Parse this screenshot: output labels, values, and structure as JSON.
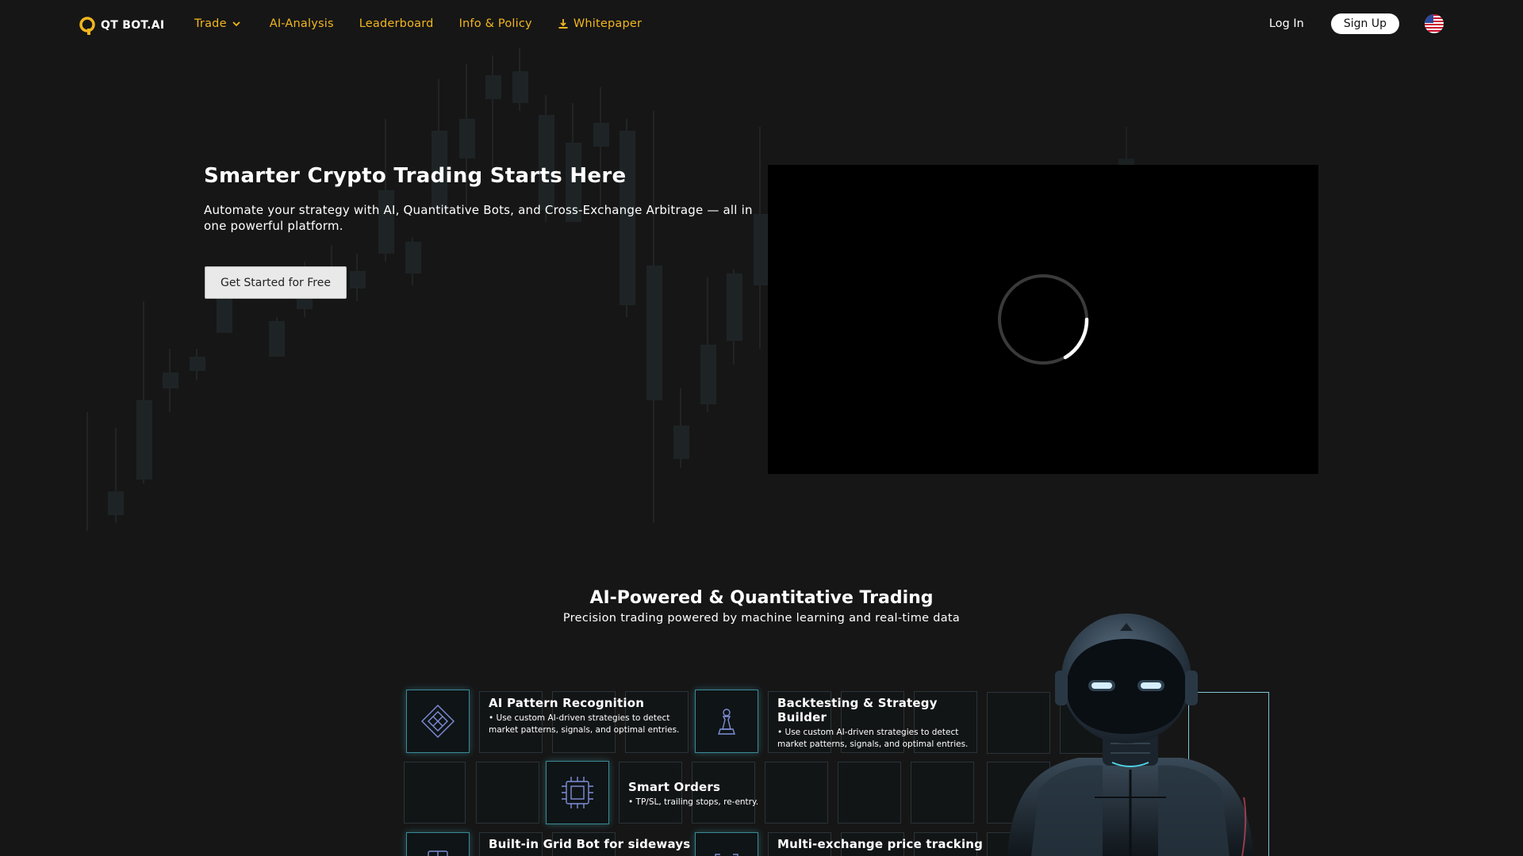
{
  "nav": {
    "logo_text": "QT BOT.AI",
    "links": [
      {
        "label": "Trade",
        "has_dropdown": true
      },
      {
        "label": "AI-Analysis"
      },
      {
        "label": "Leaderboard"
      },
      {
        "label": "Info & Policy"
      },
      {
        "label": "Whitepaper",
        "icon": "download-icon"
      }
    ],
    "login": "Log In",
    "signup": "Sign Up",
    "language_icon": "us-flag-icon"
  },
  "hero": {
    "title": "Smarter Crypto Trading Starts Here",
    "subtitle": "Automate your strategy with AI, Quantitative Bots, and Cross-Exchange Arbitrage — all in one powerful platform.",
    "cta": "Get Started for Free",
    "video_state": "loading"
  },
  "section": {
    "title": "AI-Powered & Quantitative Trading",
    "subtitle": "Precision trading powered by machine learning and real-time data"
  },
  "features": [
    {
      "title": "AI Pattern Recognition",
      "desc": "• Use custom AI-driven strategies to detect market patterns, signals, and optimal entries.",
      "icon": "puzzle-icon"
    },
    {
      "title": "Backtesting & Strategy Builder",
      "desc": "• Use custom AI-driven strategies to detect market patterns, signals, and optimal entries.",
      "icon": "chess-pawn-icon"
    },
    {
      "title": "Smart Orders",
      "desc": "• TP/SL, trailing stops, re-entry.",
      "icon": "chip-icon"
    },
    {
      "title": "Built-in Grid Bot for sideways",
      "desc": "",
      "icon": "grid-bot-icon"
    },
    {
      "title": "Multi-exchange price tracking",
      "desc": "",
      "icon": "tracking-icon"
    }
  ],
  "colors": {
    "accent": "#f2b61f",
    "background": "#161616",
    "glow": "#5cc7d6"
  }
}
